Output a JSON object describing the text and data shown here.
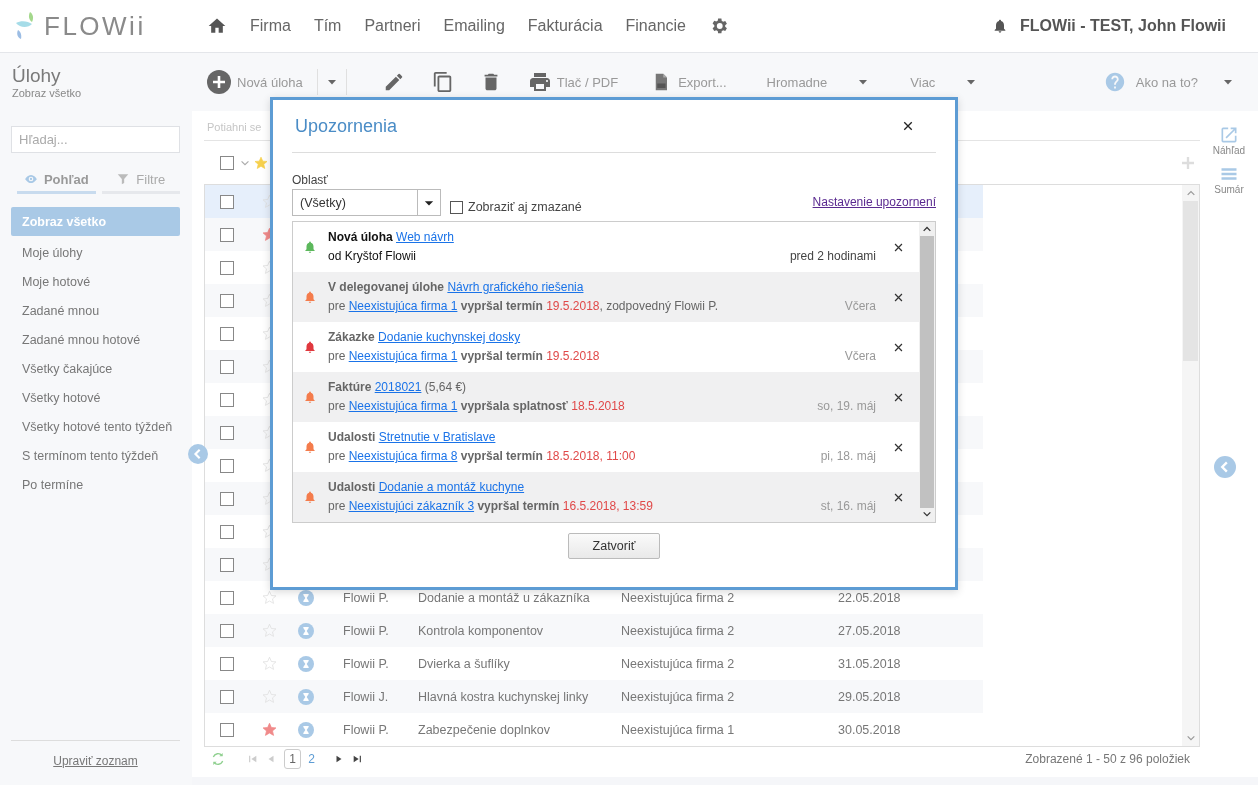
{
  "logo": "FLOWii",
  "nav": [
    "Firma",
    "Tím",
    "Partneri",
    "Emailing",
    "Fakturácia",
    "Financie"
  ],
  "user": "FLOWii - TEST, John Flowii",
  "page": {
    "title": "Úlohy",
    "subtitle": "Zobraz všetko"
  },
  "toolbar": {
    "new": "Nová úloha",
    "print": "Tlač / PDF",
    "export": "Export...",
    "bulk": "Hromadne",
    "more": "Viac",
    "help": "Ako na to?"
  },
  "sidebar": {
    "search_placeholder": "Hľadaj...",
    "tabs": [
      {
        "label": "Pohľad",
        "selected": true
      },
      {
        "label": "Filtre",
        "selected": false
      }
    ],
    "items": [
      {
        "label": "Zobraz všetko",
        "selected": true
      },
      {
        "label": "Moje úlohy",
        "selected": false
      },
      {
        "label": "Moje hotové",
        "selected": false
      },
      {
        "label": "Zadané mnou",
        "selected": false
      },
      {
        "label": "Zadané mnou hotové",
        "selected": false
      },
      {
        "label": "Všetky čakajúce",
        "selected": false
      },
      {
        "label": "Všetky hotové",
        "selected": false
      },
      {
        "label": "Všetky hotové tento týždeň",
        "selected": false
      },
      {
        "label": "S termínom tento týždeň",
        "selected": false
      },
      {
        "label": "Po termíne",
        "selected": false
      }
    ],
    "edit_link": "Upraviť zoznam"
  },
  "grid": {
    "group_hint": "Potiahni se",
    "all_checked": false,
    "rows": [
      {
        "checked": false,
        "starred": false,
        "selected": true
      },
      {
        "checked": false,
        "starred": true,
        "selected": false
      },
      {
        "checked": false,
        "starred": false,
        "selected": false
      },
      {
        "checked": false,
        "starred": false,
        "selected": false
      },
      {
        "checked": false,
        "starred": false,
        "selected": false
      },
      {
        "checked": false,
        "starred": false,
        "selected": false
      },
      {
        "checked": false,
        "starred": false,
        "selected": false
      },
      {
        "checked": false,
        "starred": false,
        "selected": false
      },
      {
        "checked": false,
        "starred": false,
        "selected": false
      },
      {
        "checked": false,
        "starred": false,
        "selected": false
      },
      {
        "checked": false,
        "starred": false,
        "selected": false
      },
      {
        "checked": false,
        "starred": false,
        "selected": false
      },
      {
        "checked": false,
        "starred": false,
        "selected": false,
        "person": "Flowii P.",
        "task": "Dodanie a montáž u zákazníka",
        "company": "Neexistujúca firma 2",
        "date": "22.05.2018"
      },
      {
        "checked": false,
        "starred": false,
        "selected": false,
        "person": "Flowii P.",
        "task": "Kontrola komponentov",
        "company": "Neexistujúca firma 2",
        "date": "27.05.2018"
      },
      {
        "checked": false,
        "starred": false,
        "selected": false,
        "person": "Flowii P.",
        "task": "Dvierka a šuflíky",
        "company": "Neexistujúca firma 2",
        "date": "31.05.2018"
      },
      {
        "checked": false,
        "starred": false,
        "selected": false,
        "person": "Flowii J.",
        "task": "Hlavná kostra kuchynskej linky",
        "company": "Neexistujúca firma 2",
        "date": "29.05.2018"
      },
      {
        "checked": false,
        "starred": true,
        "selected": false,
        "person": "Flowii P.",
        "task": "Zabezpečenie doplnkov",
        "company": "Neexistujúca firma 1",
        "date": "30.05.2018"
      }
    ],
    "pager": {
      "nav": [
        {
          "kind": "first",
          "disabled": true
        },
        {
          "kind": "prev",
          "disabled": true
        },
        {
          "kind": "next",
          "disabled": false
        },
        {
          "kind": "last",
          "disabled": false
        }
      ],
      "pages": [
        {
          "label": "1",
          "selected": true
        },
        {
          "label": "2",
          "selected": false
        }
      ],
      "summary": "Zobrazené 1 - 50 z 96 položiek"
    }
  },
  "side_actions": [
    {
      "kind": "preview",
      "label": "Náhľad"
    },
    {
      "kind": "summary",
      "label": "Sumár"
    }
  ],
  "dialog": {
    "title": "Upozornenia",
    "area_label": "Oblasť",
    "area_value": "(Všetky)",
    "show_deleted": {
      "label": "Zobraziť aj zmazané",
      "checked": false
    },
    "settings_link": "Nastavenie upozornení",
    "items": [
      {
        "color": "#5cb85c",
        "unread": true,
        "line1": [
          {
            "kind": "bold",
            "text": "Nová úloha "
          },
          {
            "kind": "link",
            "text": "Web návrh"
          }
        ],
        "line2": [
          {
            "kind": "plain",
            "text": "od Kryštof Flowii"
          }
        ],
        "time": "pred 2 hodinami"
      },
      {
        "color": "#f47c4c",
        "unread": false,
        "line1": [
          {
            "kind": "bold",
            "text": "V delegovanej úlohe "
          },
          {
            "kind": "link",
            "text": "Návrh grafického riešenia"
          }
        ],
        "line2": [
          {
            "kind": "plain",
            "text": "pre "
          },
          {
            "kind": "link",
            "text": "Neexistujúca firma 1"
          },
          {
            "kind": "bold",
            "text": " vypršal termín "
          },
          {
            "kind": "date",
            "text": "19.5.2018"
          },
          {
            "kind": "plain",
            "text": ", zodpovedný Flowii P."
          }
        ],
        "time": "Včera"
      },
      {
        "color": "#e0383e",
        "unread": false,
        "line1": [
          {
            "kind": "bold",
            "text": "Zákazke "
          },
          {
            "kind": "link",
            "text": "Dodanie kuchynskej dosky"
          }
        ],
        "line2": [
          {
            "kind": "plain",
            "text": "pre "
          },
          {
            "kind": "link",
            "text": "Neexistujúca firma 1"
          },
          {
            "kind": "bold",
            "text": " vypršal termín "
          },
          {
            "kind": "date",
            "text": "19.5.2018"
          }
        ],
        "time": "Včera"
      },
      {
        "color": "#f47c4c",
        "unread": false,
        "line1": [
          {
            "kind": "bold",
            "text": "Faktúre "
          },
          {
            "kind": "link",
            "text": "2018021"
          },
          {
            "kind": "plain",
            "text": " (5,64 €)"
          }
        ],
        "line2": [
          {
            "kind": "plain",
            "text": "pre "
          },
          {
            "kind": "link",
            "text": "Neexistujúca firma 1"
          },
          {
            "kind": "bold",
            "text": " vypršala splatnosť "
          },
          {
            "kind": "date",
            "text": "18.5.2018"
          }
        ],
        "time": "so, 19. máj"
      },
      {
        "color": "#f47c4c",
        "unread": false,
        "line1": [
          {
            "kind": "bold",
            "text": "Udalosti "
          },
          {
            "kind": "link",
            "text": "Stretnutie v Bratislave"
          }
        ],
        "line2": [
          {
            "kind": "plain",
            "text": "pre "
          },
          {
            "kind": "link",
            "text": "Neexistujúca firma 8"
          },
          {
            "kind": "bold",
            "text": " vypršal termín "
          },
          {
            "kind": "date",
            "text": "18.5.2018, 11:00"
          }
        ],
        "time": "pi, 18. máj"
      },
      {
        "color": "#f47c4c",
        "unread": false,
        "line1": [
          {
            "kind": "bold",
            "text": "Udalosti "
          },
          {
            "kind": "link",
            "text": "Dodanie a montáž kuchyne"
          }
        ],
        "line2": [
          {
            "kind": "plain",
            "text": "pre "
          },
          {
            "kind": "link",
            "text": "Neexistujúci zákazník 3"
          },
          {
            "kind": "bold",
            "text": " vypršal termín "
          },
          {
            "kind": "date",
            "text": "16.5.2018, 13:59"
          }
        ],
        "time": "st, 16. máj"
      }
    ],
    "close_button": "Zatvoriť"
  }
}
